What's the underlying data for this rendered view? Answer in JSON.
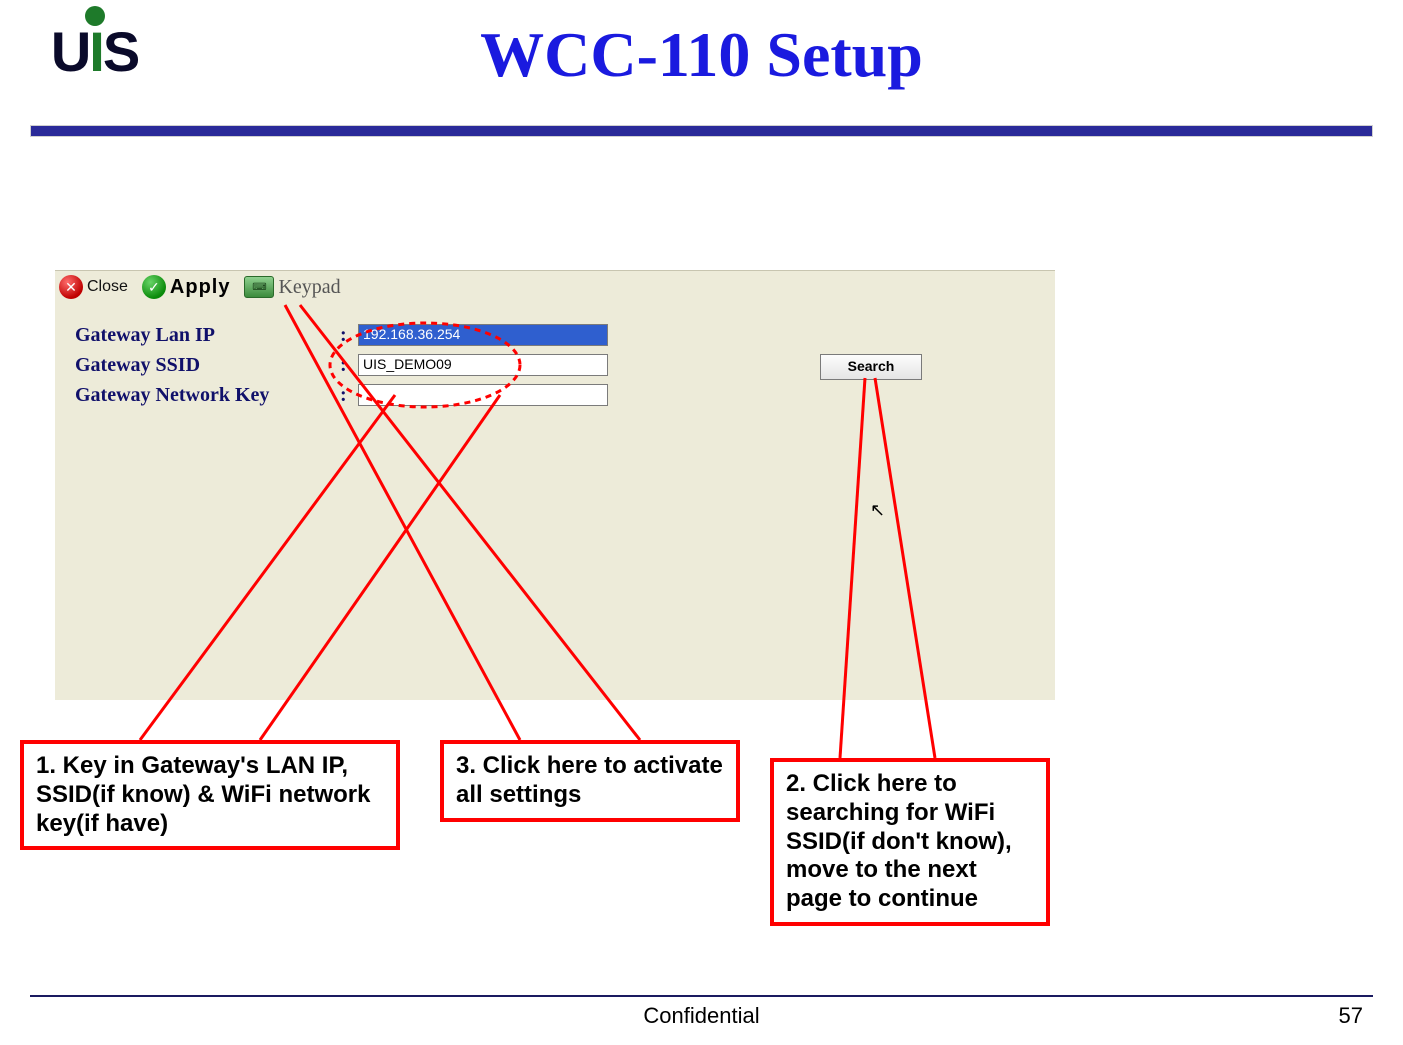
{
  "header": {
    "logo_text_left": "U",
    "logo_text_mid": "I",
    "logo_text_right": "S",
    "title": "WCC-110 Setup"
  },
  "toolbar": {
    "close_label": "Close",
    "apply_label": "Apply",
    "keypad_label": "Keypad"
  },
  "form": {
    "lan_ip_label": "Gateway Lan IP",
    "lan_ip_value": "192.168.36.254",
    "ssid_label": "Gateway SSID",
    "ssid_value": "UIS_DEMO09",
    "key_label": "Gateway Network Key",
    "key_value": "",
    "search_label": "Search"
  },
  "callouts": {
    "c1": "1. Key in Gateway's LAN IP, SSID(if know) & WiFi network key(if have)",
    "c2": "2. Click here to searching for WiFi SSID(if don't know), move to the next page to continue",
    "c3": "3. Click here to activate all settings"
  },
  "footer": {
    "confidential": "Confidential",
    "page": "57"
  }
}
